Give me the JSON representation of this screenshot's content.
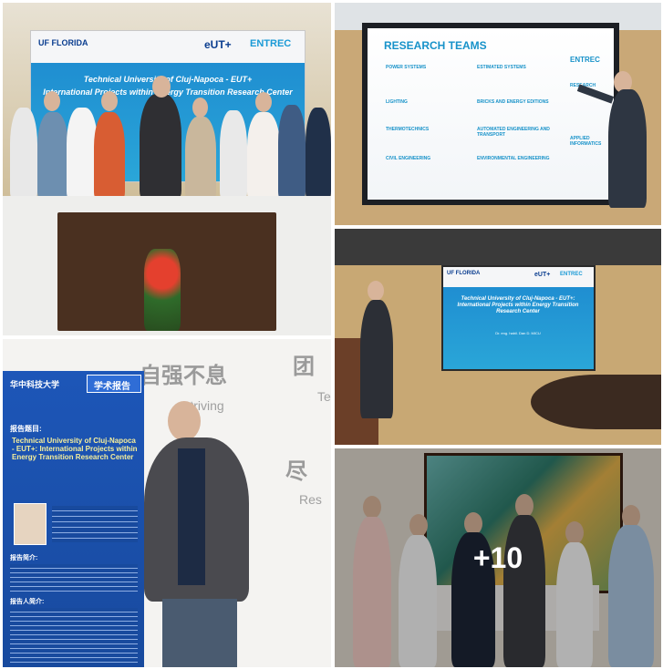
{
  "gallery": {
    "more_count_label": "+10"
  },
  "tile1": {
    "logos": [
      "UF FLORIDA",
      "eUT+",
      "ENTREC"
    ],
    "banner_title": "Technical University of Cluj-Napoca - EUT+",
    "banner_sub": "International Projects within Energy Transition Research Center"
  },
  "tile2": {
    "heading": "RESEARCH TEAMS",
    "brand": "ENTREC",
    "sections": [
      "POWER SYSTEMS",
      "LIGHTING",
      "THERMOTECHNICS",
      "CIVIL ENGINEERING",
      "ESTIMATED SYSTEMS",
      "BRICKS AND ENERGY EDITIONS",
      "AUTOMATED ENGINEERING AND TRANSPORT",
      "ENVIRONMENTAL ENGINEERING",
      "RESEARCH",
      "APPLIED INFORMATICS"
    ]
  },
  "tile3": {
    "logos": [
      "UF FLORIDA",
      "eUT+",
      "ENTREC"
    ],
    "slide_title": "Technical University of Cluj-Napoca - EUT+: International Projects within Energy Transition Research Center",
    "slide_author": "Dr. eng. habil. Dan D. MICU"
  },
  "tile4": {
    "poster_header": "华中科技大学",
    "poster_tag": "学术报告",
    "poster_title_label": "报告题目:",
    "poster_title": "Technical University of Cluj-Napoca - EUT+: International Projects within Energy Transition Research Center",
    "poster_intro_label": "报告简介:",
    "poster_bio_label": "报告人简介:",
    "wall_text": "自强不息",
    "wall_text_2": "团",
    "wall_en": "Striving",
    "wall_en_2": "Te",
    "wall_text_3": "尽",
    "wall_en_3": "Res"
  },
  "tile5": {
    "count": "+10"
  }
}
